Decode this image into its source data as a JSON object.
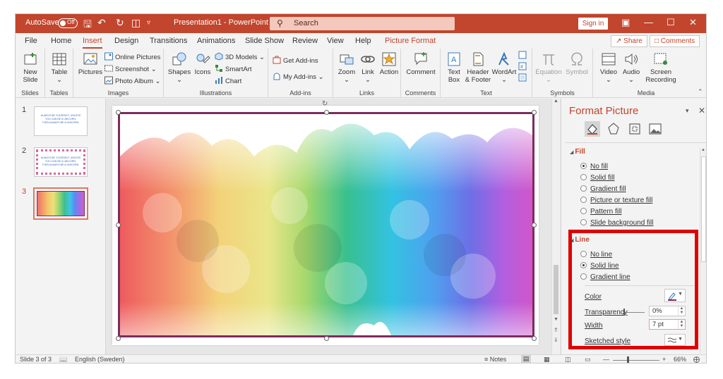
{
  "titlebar": {
    "autosave_label": "AutoSave",
    "autosave_state": "Off",
    "document_title": "Presentation1 - PowerPoint",
    "search_placeholder": "Search",
    "signin_label": "Sign in"
  },
  "tabs": [
    "File",
    "Home",
    "Insert",
    "Design",
    "Transitions",
    "Animations",
    "Slide Show",
    "Review",
    "View",
    "Help",
    "Picture Format"
  ],
  "active_tab": "Insert",
  "share_label": "Share",
  "comments_label": "Comments",
  "ribbon": {
    "slides": {
      "new_slide": "New",
      "new_slide2": "Slide",
      "group": "Slides"
    },
    "tables": {
      "table": "Table",
      "group": "Tables"
    },
    "images": {
      "pictures": "Pictures",
      "online_pictures": "Online Pictures",
      "screenshot": "Screenshot",
      "photo_album": "Photo Album",
      "group": "Images"
    },
    "illustrations": {
      "shapes": "Shapes",
      "icons": "Icons",
      "models3d": "3D Models",
      "smartart": "SmartArt",
      "chart": "Chart",
      "group": "Illustrations"
    },
    "addins": {
      "get_addins": "Get Add-ins",
      "my_addins": "My Add-ins",
      "group": "Add-ins"
    },
    "links": {
      "zoom": "Zoom",
      "link": "Link",
      "action": "Action",
      "group": "Links"
    },
    "comments": {
      "comment": "Comment",
      "group": "Comments"
    },
    "text": {
      "textbox1": "Text",
      "textbox2": "Box",
      "header1": "Header",
      "header2": "& Footer",
      "wordart": "WordArt",
      "group": "Text"
    },
    "symbols": {
      "equation": "Equation",
      "symbol": "Symbol",
      "group": "Symbols"
    },
    "media": {
      "video": "Video",
      "audio": "Audio",
      "screen1": "Screen",
      "screen2": "Recording",
      "group": "Media"
    }
  },
  "slides": [
    {
      "number": "1",
      "line1": "ALWAYS BE YOURSELF, UNLESS",
      "line2": "YOU CAN BE A UNICORN.",
      "line3": "THEN ALWAYS BE A UNICORN."
    },
    {
      "number": "2",
      "line1": "ALWAYS BE YOURSELF, UNLESS",
      "line2": "YOU CAN BE A UNICORN.",
      "line3": "THEN ALWAYS BE A UNICORN."
    },
    {
      "number": "3"
    }
  ],
  "pane": {
    "title": "Format Picture",
    "fill_section": "Fill",
    "fill_options": [
      "No fill",
      "Solid fill",
      "Gradient fill",
      "Picture or texture fill",
      "Pattern fill",
      "Slide background fill"
    ],
    "fill_selected": "No fill",
    "line_section": "Line",
    "line_options": [
      "No line",
      "Solid line",
      "Gradient line"
    ],
    "line_selected": "Solid line",
    "color_label": "Color",
    "transparency_label": "Transparency",
    "transparency_value": "0%",
    "width_label": "Width",
    "width_value": "7 pt",
    "sketched_label": "Sketched style"
  },
  "status": {
    "slide_info": "Slide 3 of 3",
    "language": "English (Sweden)",
    "notes": "Notes",
    "zoom": "66%"
  },
  "colors": {
    "accent": "#c2452d",
    "picture_border": "#7b2c5c",
    "highlight": "#e00000"
  }
}
